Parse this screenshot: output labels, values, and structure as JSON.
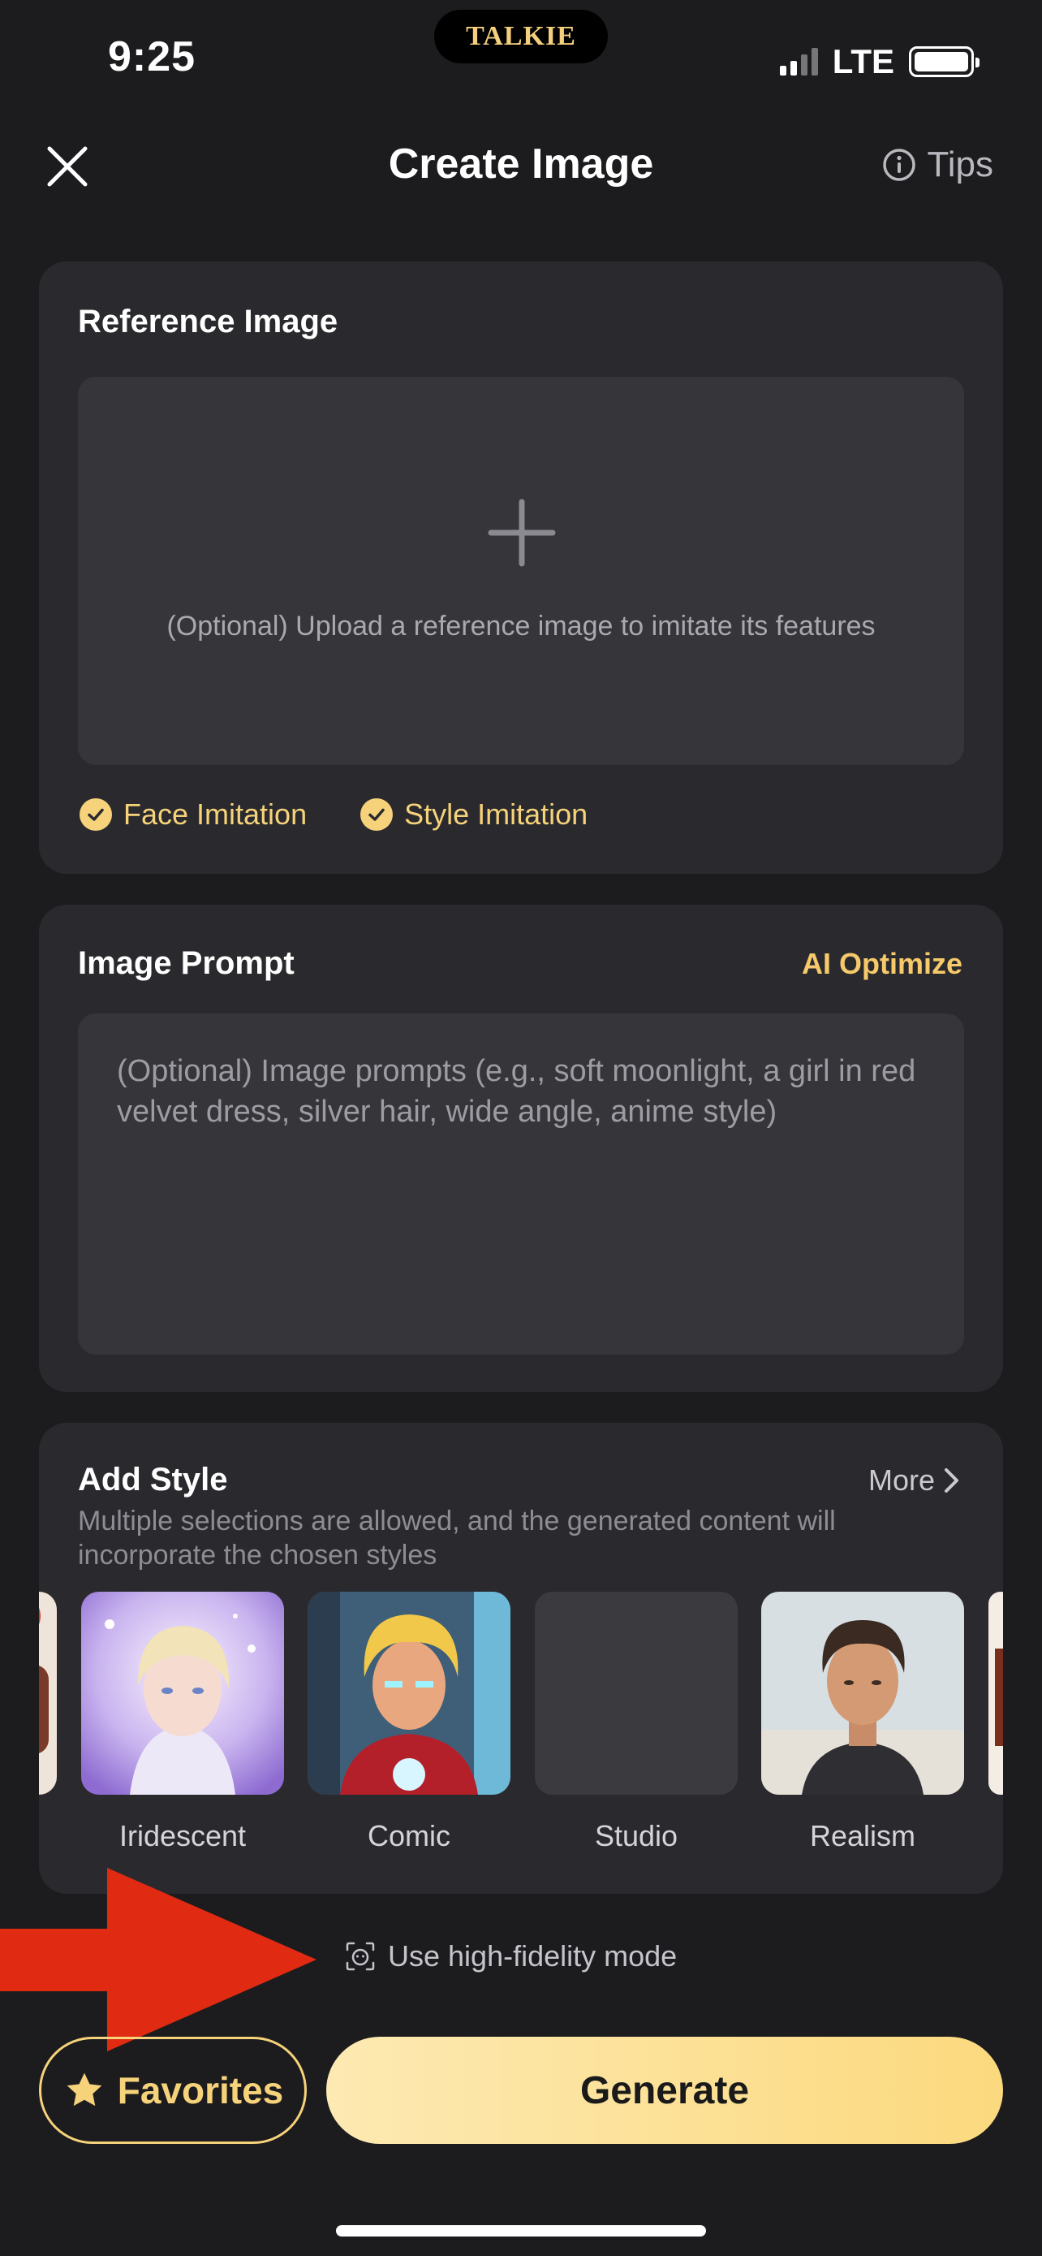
{
  "status": {
    "time": "9:25",
    "network": "LTE",
    "island_logo": "TALKIE"
  },
  "header": {
    "title": "Create Image",
    "tips_label": "Tips"
  },
  "reference": {
    "title": "Reference Image",
    "upload_text": "(Optional) Upload a reference image to imitate its features",
    "options": [
      "Face Imitation",
      "Style Imitation"
    ]
  },
  "prompt": {
    "title": "Image Prompt",
    "ai_optimize": "AI Optimize",
    "placeholder": "(Optional) Image prompts (e.g., soft moonlight, a girl in red velvet dress, silver hair, wide angle, anime style)"
  },
  "style": {
    "title": "Add Style",
    "more": "More",
    "description": "Multiple selections are allowed, and the generated content will incorporate the chosen styles",
    "items": [
      {
        "label": "Iridescent"
      },
      {
        "label": "Comic"
      },
      {
        "label": "Studio"
      },
      {
        "label": "Realism"
      }
    ]
  },
  "footer": {
    "hifi_label": "Use high-fidelity mode",
    "favorites_label": "Favorites",
    "generate_label": "Generate"
  },
  "colors": {
    "accent": "#f6d27a",
    "background": "#1c1c1f",
    "card": "#2a2a2e",
    "annotation_arrow": "#e02a12"
  }
}
